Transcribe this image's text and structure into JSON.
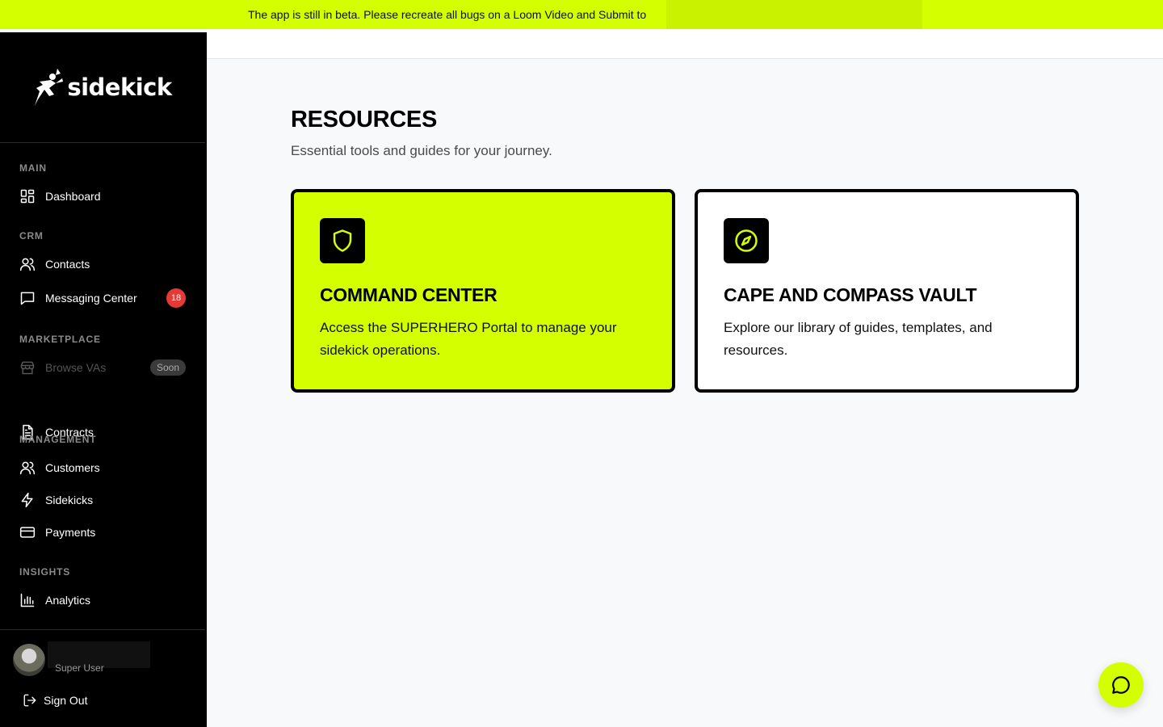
{
  "banner": {
    "text": "The app is still in beta. Please recreate all bugs on a Loom Video and Submit to"
  },
  "brand": {
    "name": "sidekick",
    "accent": "#d4ff00"
  },
  "sidebar": {
    "sections": {
      "main": "MAIN",
      "crm": "CRM",
      "marketplace": "MARKETPLACE",
      "management": "MANAGEMENT",
      "insights": "INSIGHTS"
    },
    "items": {
      "dashboard": {
        "label": "Dashboard",
        "icon": "grid-icon"
      },
      "contacts": {
        "label": "Contacts",
        "icon": "users-icon"
      },
      "messaging": {
        "label": "Messaging Center",
        "icon": "message-icon",
        "badge": "18"
      },
      "browse_vas": {
        "label": "Browse VAs",
        "icon": "store-icon",
        "badge": "Soon"
      },
      "contracts": {
        "label": "Contracts",
        "icon": "document-icon"
      },
      "customers": {
        "label": "Customers",
        "icon": "users-icon"
      },
      "sidekicks": {
        "label": "Sidekicks",
        "icon": "lightning-icon"
      },
      "payments": {
        "label": "Payments",
        "icon": "credit-card-icon"
      },
      "analytics": {
        "label": "Analytics",
        "icon": "bar-chart-icon"
      }
    },
    "user": {
      "role": "Super User"
    },
    "sign_out": "Sign Out"
  },
  "main": {
    "title": "RESOURCES",
    "subtitle": "Essential tools and guides for your journey.",
    "cards": [
      {
        "title": "COMMAND CENTER",
        "description": "Access the SUPERHERO Portal to manage your sidekick operations.",
        "icon": "shield-icon"
      },
      {
        "title": "CAPE AND COMPASS VAULT",
        "description": "Explore our library of guides, templates, and resources.",
        "icon": "compass-icon"
      }
    ]
  },
  "chat": {
    "icon": "chat-bubble-icon"
  }
}
